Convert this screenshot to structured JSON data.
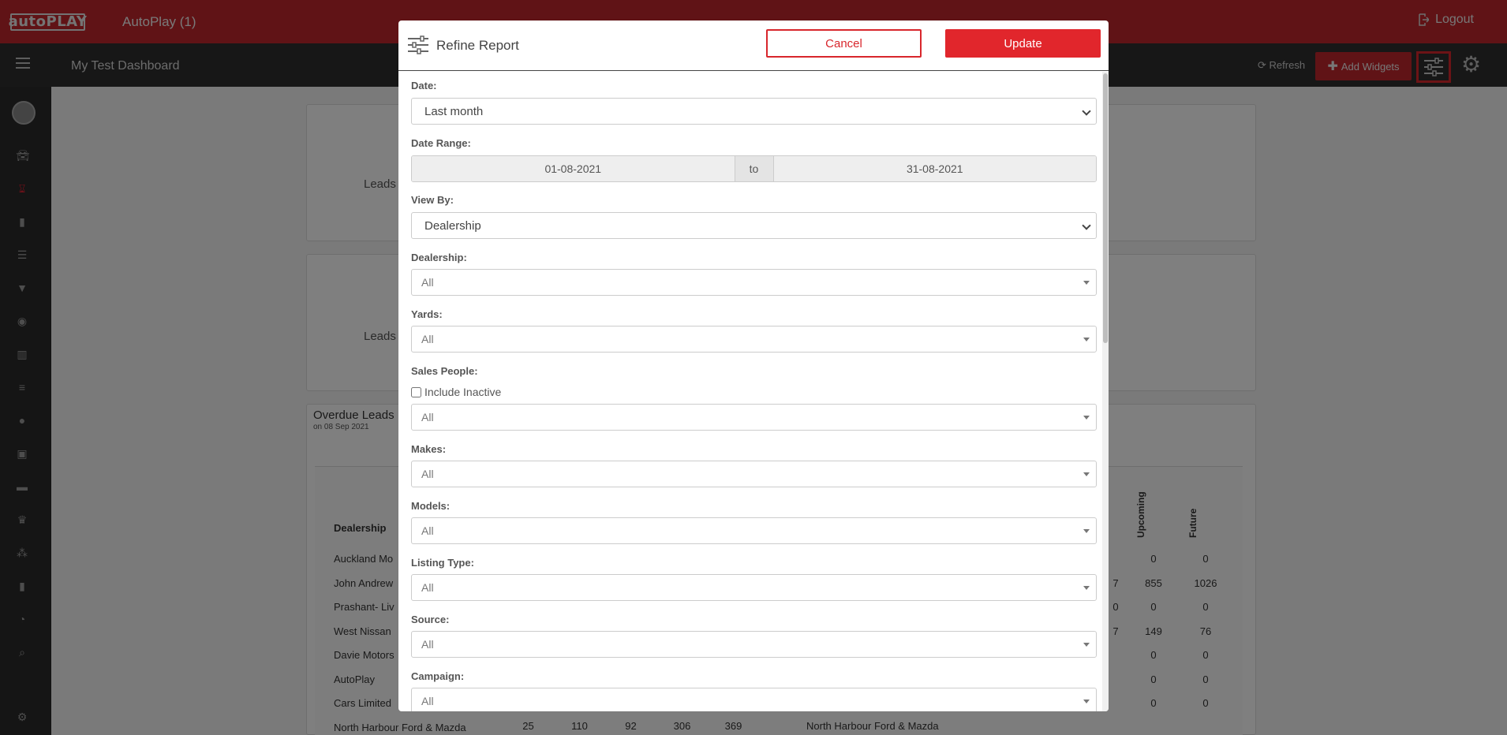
{
  "topbar": {
    "logo": "autoPLAY",
    "app_title": "AutoPlay (1)",
    "logout": "Logout"
  },
  "subbar": {
    "dashboard_title": "My Test Dashboard",
    "refresh": "Refresh",
    "add_widgets": "Add Widgets"
  },
  "background": {
    "leads_label_1": "Leads",
    "leads_label_2": "Leads",
    "overdue_title": "Overdue Leads",
    "overdue_date": "on 08 Sep 2021",
    "table_header": "Dealership",
    "col_upcoming": "Upcoming",
    "col_future": "Future",
    "left_rows": [
      "Auckland Mo",
      "John Andrew",
      "Prashant- Liv",
      "West Nissan",
      "Davie Motors",
      "AutoPlay",
      "Cars Limited",
      "North Harbour Ford & Mazda"
    ],
    "last_row_values": [
      "25",
      "110",
      "92",
      "306",
      "369"
    ],
    "right_cells": [
      [
        "",
        "0",
        "0"
      ],
      [
        "7",
        "855",
        "1026"
      ],
      [
        "0",
        "0",
        "0"
      ],
      [
        "7",
        "149",
        "76"
      ],
      [
        "",
        "0",
        "0"
      ],
      [
        "",
        "0",
        "0"
      ],
      [
        "",
        "0",
        "0"
      ]
    ],
    "right_last_row": "North Harbour Ford & Mazda"
  },
  "modal": {
    "title": "Refine Report",
    "cancel": "Cancel",
    "update": "Update",
    "date_label": "Date:",
    "date_value": "Last month",
    "date_range_label": "Date Range:",
    "date_from": "01-08-2021",
    "date_to_word": "to",
    "date_to": "31-08-2021",
    "view_by_label": "View By:",
    "view_by_value": "Dealership",
    "dealership_label": "Dealership:",
    "dealership_value": "All",
    "yards_label": "Yards:",
    "yards_value": "All",
    "sales_people_label": "Sales People:",
    "include_inactive": "Include Inactive",
    "sales_people_value": "All",
    "makes_label": "Makes:",
    "makes_value": "All",
    "models_label": "Models:",
    "models_value": "All",
    "listing_type_label": "Listing Type:",
    "listing_type_value": "All",
    "source_label": "Source:",
    "source_value": "All",
    "campaign_label": "Campaign:",
    "campaign_value": "All"
  }
}
